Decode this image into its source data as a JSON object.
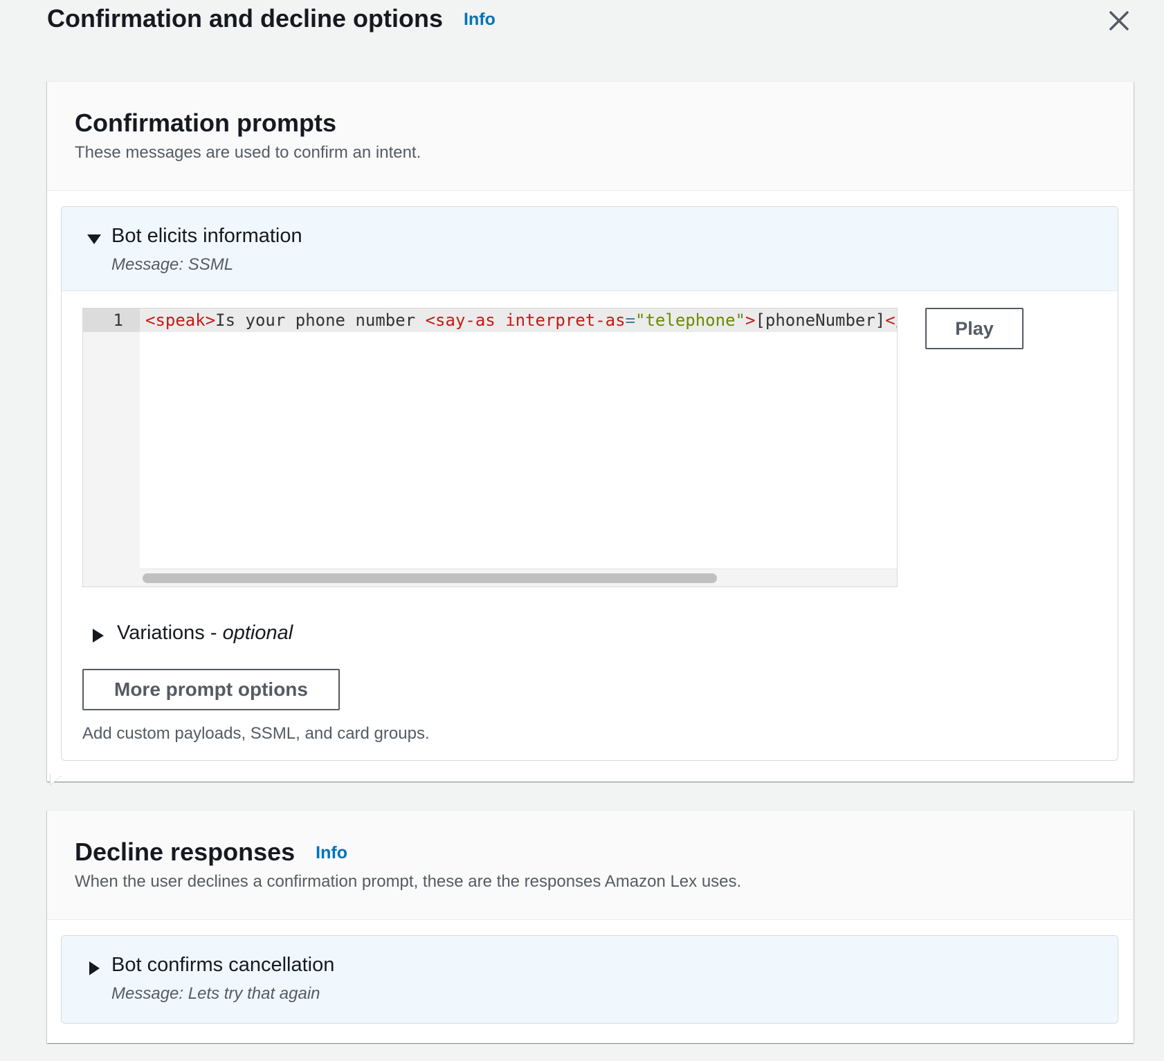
{
  "modal": {
    "title": "Confirmation and decline options",
    "info_label": "Info"
  },
  "confirmation": {
    "title": "Confirmation prompts",
    "description": "These messages are used to confirm an intent.",
    "expander": {
      "title": "Bot elicits information",
      "subtitle": "Message: SSML"
    },
    "editor": {
      "line_number": "1",
      "code": {
        "t1": "<speak>",
        "t2": "Is your phone number ",
        "t3": "<say-as ",
        "t4": "interpret-as",
        "t5": "=",
        "t6": "\"telephone\"",
        "t7": ">",
        "t8": "[phoneNumber]",
        "t9": "</"
      }
    },
    "play_label": "Play",
    "variations": {
      "label": "Variations - ",
      "optional": "optional"
    },
    "more_prompt_label": "More prompt options",
    "more_prompt_desc": "Add custom payloads, SSML, and card groups."
  },
  "decline": {
    "title": "Decline responses",
    "info_label": "Info",
    "description": "When the user declines a confirmation prompt, these are the responses Amazon Lex uses.",
    "expander": {
      "title": "Bot confirms cancellation",
      "subtitle": "Message: Lets try that again"
    }
  },
  "icons": {
    "close": "close-icon",
    "caret_down": "caret-down-icon",
    "caret_right": "caret-right-icon"
  },
  "colors": {
    "link": "#0073bb",
    "tag": "#c41a16",
    "string": "#6a8a00",
    "expander_header": "#f1f8fd"
  }
}
